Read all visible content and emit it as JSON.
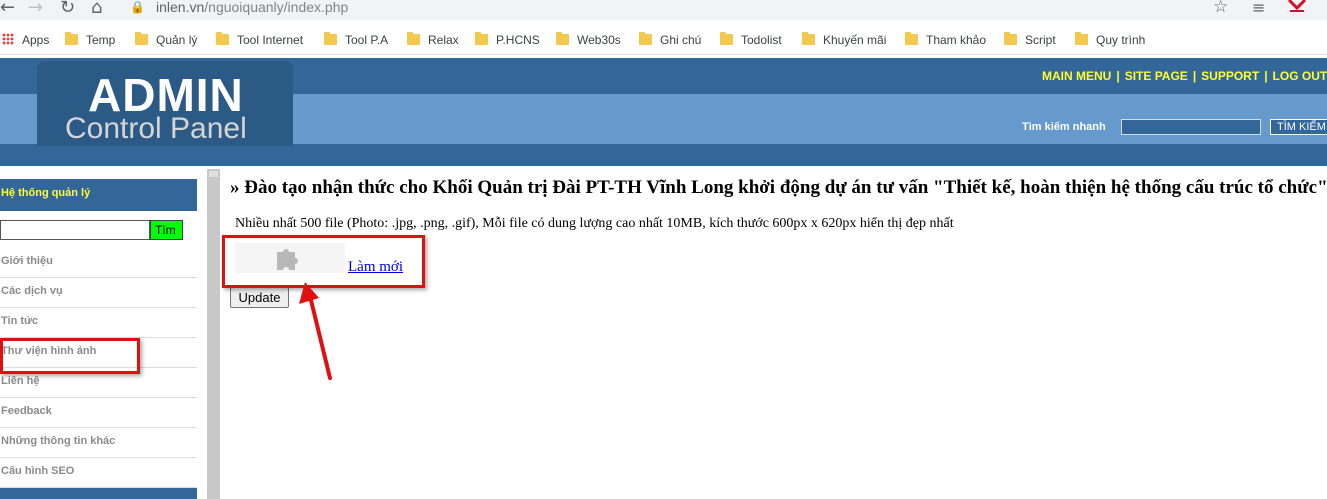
{
  "browser": {
    "url_domain": "inlen.vn",
    "url_path": "/nguoiquanly/index.php",
    "bookmarks": [
      "Apps",
      "Temp",
      "Quản lý",
      "Tool Internet",
      "Tool P.A",
      "Relax",
      "P.HCNS",
      "Web30s",
      "Ghi chú",
      "Todolist",
      "Khuyến mãi",
      "Tham khảo",
      "Script",
      "Quy trình"
    ]
  },
  "header": {
    "logo_line1": "ADMIN",
    "logo_line2": "Control Panel",
    "nav": [
      "MAIN MENU",
      "SITE PAGE",
      "SUPPORT",
      "LOG OUT"
    ],
    "search_label": "Tìm kiếm nhanh",
    "search_button": "TÌM KIẾM"
  },
  "sidebar": {
    "title": "Hệ thống quản lý",
    "search_button": "Tìm",
    "items": [
      "Giới thiệu",
      "Các dịch vụ",
      "Tin tức",
      "Thư viện hình ảnh",
      "Liên hệ",
      "Feedback",
      "Những thông tin khác",
      "Cấu hình SEO"
    ]
  },
  "main": {
    "title": "» Đào tạo nhận thức cho Khối Quản trị Đài PT-TH Vĩnh Long khởi động dự án tư vấn \"Thiết kế, hoàn thiện hệ thống cấu trúc tổ chức\"",
    "note": "Nhiều nhất 500 file (Photo: .jpg, .png, .gif), Mỗi file có dung lượng cao nhất 10MB, kích thước 600px x 620px hiển thị đẹp nhất",
    "refresh_link": "Làm mới",
    "update_button": "Update"
  },
  "colors": {
    "header_dark": "#336699",
    "header_light": "#6699cc",
    "nav_yellow": "#ffff33",
    "highlight_red": "#e01010",
    "search_green": "#00ff00"
  }
}
